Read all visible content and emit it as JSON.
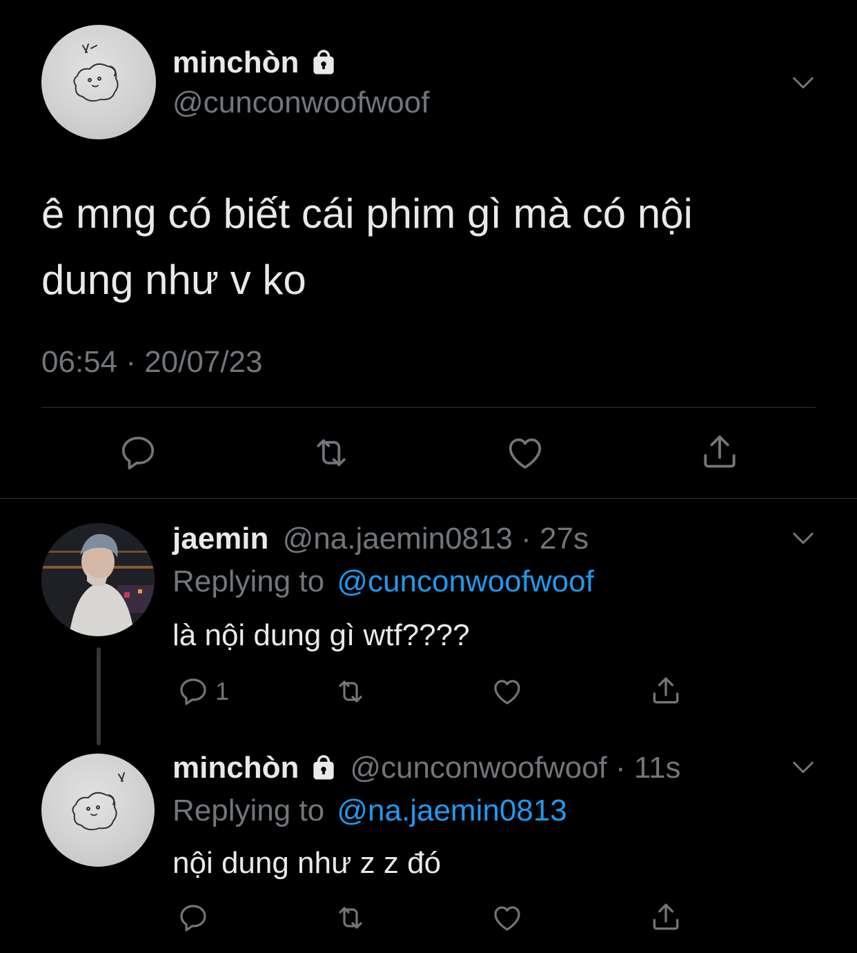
{
  "main_tweet": {
    "name": "minchòn",
    "handle": "@cunconwoofwoof",
    "text_line1": "ê mng có biết cái phim gì mà có nội",
    "text_line2": "dung như v ko",
    "timestamp": "06:54 · 20/07/23"
  },
  "reply1": {
    "name": "jaemin",
    "meta": "@na.jaemin0813 · 27s",
    "replying_prefix": "Replying to",
    "replying_to": "@cunconwoofwoof",
    "text": "là nội dung gì wtf????",
    "reply_count": "1"
  },
  "reply2": {
    "name": "minchòn",
    "meta": "@cunconwoofwoof · 11s",
    "replying_prefix": "Replying to",
    "replying_to": "@na.jaemin0813",
    "text": "nội dung như z z đó"
  },
  "colors": {
    "background": "#000000",
    "text": "#e7e9ea",
    "secondary": "#71767b",
    "link": "#1d9bf0"
  },
  "icons": [
    "lock-icon",
    "chevron-down-icon",
    "reply-icon",
    "retweet-icon",
    "like-icon",
    "share-icon"
  ]
}
